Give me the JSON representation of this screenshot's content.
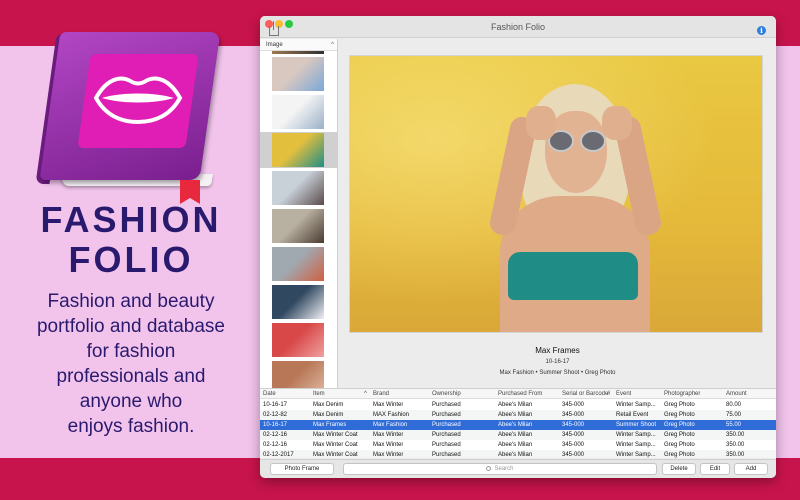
{
  "promo": {
    "title_line1": "FASHION",
    "title_line2": "FOLIO",
    "tagline_lines": [
      "Fashion and beauty",
      "portfolio and database",
      "for fashion",
      "professionals and",
      "anyone who",
      "enjoys fashion."
    ]
  },
  "window": {
    "title": "Fashion Folio",
    "info_glyph": "i"
  },
  "sidebar": {
    "header": "Image",
    "caret": "^",
    "selected_index": 2,
    "thumbnails": [
      {
        "colors": [
          "#d8c8c0",
          "#7aa8d8"
        ]
      },
      {
        "colors": [
          "#f4f4f4",
          "#9bb0c8"
        ]
      },
      {
        "colors": [
          "#e3bf3e",
          "#1f8d86"
        ]
      },
      {
        "colors": [
          "#c8d0d8",
          "#5a4a48"
        ]
      },
      {
        "colors": [
          "#b8b0a0",
          "#4a3a30"
        ]
      },
      {
        "colors": [
          "#a0a8b0",
          "#d06040"
        ]
      },
      {
        "colors": [
          "#304860",
          "#f0f0f4"
        ]
      },
      {
        "colors": [
          "#d84848",
          "#f0a0a0"
        ]
      },
      {
        "colors": [
          "#b87858",
          "#e0b8a0"
        ]
      }
    ]
  },
  "photo": {
    "caption_title": "Max Frames",
    "caption_date": "10-16-17",
    "caption_meta": "Max Fashion • Summer Shoot • Greg Photo"
  },
  "table": {
    "columns": [
      "Date",
      "Item",
      "Brand",
      "Ownership",
      "Purchased From",
      "Serial or Barcode",
      "#",
      "Event",
      "Photographer",
      "Amount"
    ],
    "sort_glyph": "^",
    "selected_row": 2,
    "rows": [
      [
        "10-16-17",
        "Max Denim",
        "Max Winter",
        "Purchased",
        "Abee's Milan",
        "345-000",
        "",
        "Winter Samp...",
        "Greg Photo",
        "80.00"
      ],
      [
        "02-12-82",
        "Max Denim",
        "MAX Fashion",
        "Purchased",
        "Abee's Milan",
        "345-000",
        "",
        "Retail Event",
        "Greg Photo",
        "75.00"
      ],
      [
        "10-16-17",
        "Max Frames",
        "Max Fashion",
        "Purchased",
        "Abee's Milan",
        "345-000",
        "",
        "Summer Shoot",
        "Greg Photo",
        "55.00"
      ],
      [
        "02-12-16",
        "Max Winter Coat",
        "Max Winter",
        "Purchased",
        "Abee's Milan",
        "345-000",
        "",
        "Winter Samp...",
        "Greg Photo",
        "350.00"
      ],
      [
        "02-12-16",
        "Max Winter Coat",
        "Max Winter",
        "Purchased",
        "Abee's Milan",
        "345-000",
        "",
        "Winter Samp...",
        "Greg Photo",
        "350.00"
      ],
      [
        "02-12-2017",
        "Max Winter Coat",
        "Max Winter",
        "Purchased",
        "Abee's Milan",
        "345-000",
        "",
        "Winter Samp...",
        "Greg Photo",
        "350.00"
      ]
    ]
  },
  "toolbar": {
    "photo_frame_label": "Photo Frame",
    "search_placeholder": "Search",
    "delete_label": "Delete",
    "edit_label": "Edit",
    "add_label": "Add"
  },
  "colors": {
    "band": "#c8144c",
    "panel": "#f2c4ec",
    "title_text": "#2a1a6e",
    "selection": "#2f6cd8"
  }
}
